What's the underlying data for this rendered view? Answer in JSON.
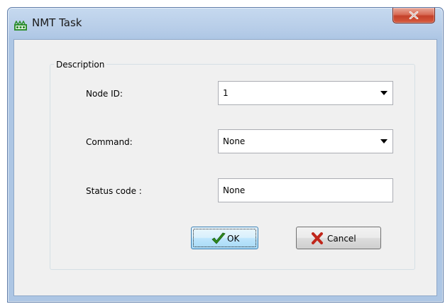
{
  "window": {
    "title": "NMT Task",
    "close_symbol": "x",
    "icon": "can-logo-icon"
  },
  "group": {
    "legend": "Description"
  },
  "fields": {
    "node_id": {
      "label": "Node ID:",
      "value": "1"
    },
    "command": {
      "label": "Command:",
      "value": "None"
    },
    "status_code": {
      "label": "Status code :",
      "value": "None"
    }
  },
  "buttons": {
    "ok": {
      "label": "OK",
      "icon": "checkmark-icon",
      "icon_color": "#2e8b1e"
    },
    "cancel": {
      "label": "Cancel",
      "icon": "red-x-icon",
      "icon_color": "#c0261b"
    }
  }
}
